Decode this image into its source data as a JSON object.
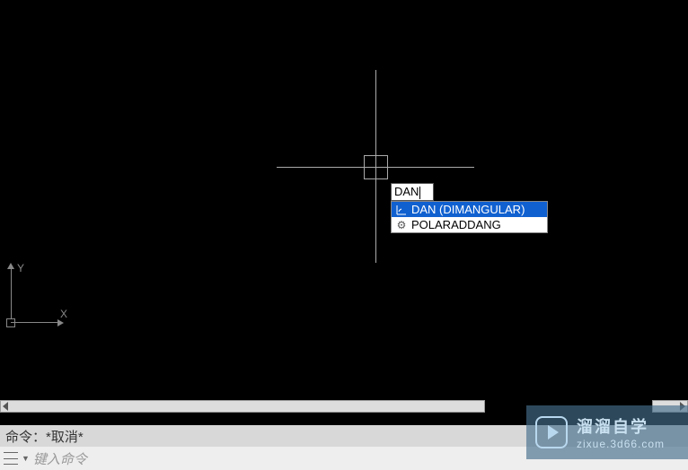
{
  "drawing": {
    "ucs": {
      "x_label": "X",
      "y_label": "Y"
    }
  },
  "dynamic_input": {
    "value": "DAN"
  },
  "autocomplete": {
    "items": [
      {
        "label": "DAN (DIMANGULAR)",
        "icon": "dimension-angular-icon",
        "selected": true
      },
      {
        "label": "POLARADDANG",
        "icon": "gear-icon",
        "selected": false
      }
    ]
  },
  "command_line": {
    "history": "命令：*取消*",
    "placeholder": "键入命令"
  },
  "watermark": {
    "title": "溜溜自学",
    "url": "zixue.3d66.com"
  }
}
